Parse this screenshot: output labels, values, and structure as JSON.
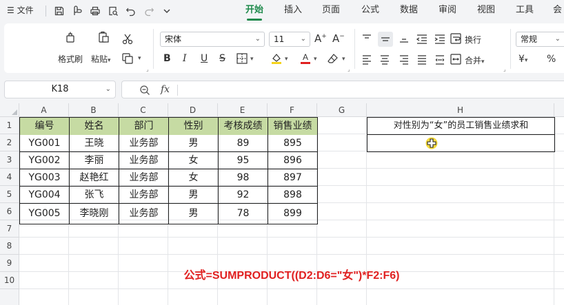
{
  "menubar": {
    "menu_label": "文件",
    "tabs": [
      {
        "label": "开始",
        "active": true
      },
      {
        "label": "插入"
      },
      {
        "label": "页面"
      },
      {
        "label": "公式"
      },
      {
        "label": "数据"
      },
      {
        "label": "审阅"
      },
      {
        "label": "视图"
      },
      {
        "label": "工具"
      },
      {
        "label": "会"
      }
    ]
  },
  "ribbon": {
    "format_painter_label": "格式刷",
    "paste_label": "粘贴",
    "font_name": "宋体",
    "font_size": "11",
    "wrap_label": "换行",
    "merge_label": "合并",
    "number_format": "常规",
    "currency_symbol": "¥",
    "percent_symbol": "%",
    "bold_label": "B",
    "italic_label": "I",
    "underline_label": "U",
    "strike_label": "S",
    "font_color_glyph": "A",
    "increase_font_glyph": "A",
    "decrease_font_glyph": "A",
    "colors": {
      "highlight": "#f5d31b",
      "font_color": "#e02020"
    }
  },
  "formula_bar": {
    "cell_ref": "K18",
    "fx_label": "fx",
    "formula": ""
  },
  "sheet": {
    "columns": [
      "A",
      "B",
      "C",
      "D",
      "E",
      "F",
      "G",
      "H"
    ],
    "rows": [
      "1",
      "2",
      "3",
      "4",
      "5",
      "6",
      "7",
      "8",
      "9",
      "10"
    ],
    "table_header": [
      "编号",
      "姓名",
      "部门",
      "性别",
      "考核成绩",
      "销售业绩"
    ],
    "table_rows": [
      [
        "YG001",
        "王晓",
        "业务部",
        "男",
        "89",
        "895"
      ],
      [
        "YG002",
        "李丽",
        "业务部",
        "女",
        "95",
        "896"
      ],
      [
        "YG003",
        "赵艳红",
        "业务部",
        "女",
        "98",
        "897"
      ],
      [
        "YG004",
        "张飞",
        "业务部",
        "男",
        "92",
        "898"
      ],
      [
        "YG005",
        "李晓刚",
        "业务部",
        "男",
        "78",
        "899"
      ]
    ],
    "h1_text": "对性别为“女”的员工销售业绩求和",
    "h2_text": "",
    "header_color": "#c6dba3",
    "note": "公式=SUMPRODUCT((D2:D6=\"女\")*F2:F6)",
    "note_color": "#e02020"
  }
}
